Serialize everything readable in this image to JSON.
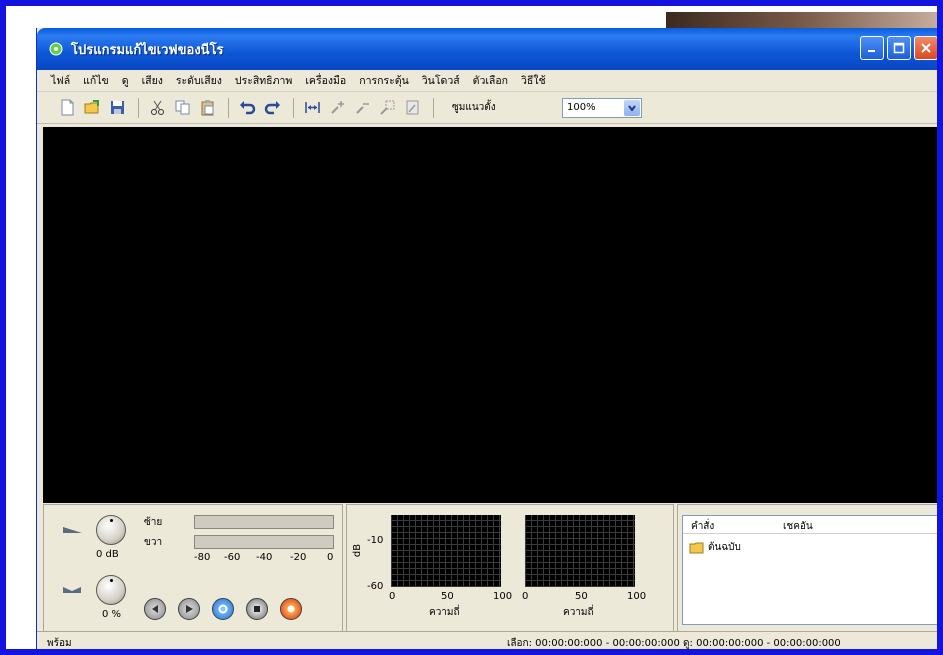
{
  "window": {
    "title": "โปรแกรมแก้ไขเวฟของนีโร",
    "controls": {
      "minimize": "minimize",
      "maximize": "maximize",
      "close": "close"
    }
  },
  "menu": [
    "ไฟล์",
    "แก้ไข",
    "ดู",
    "เสียง",
    "ระดับเสียง",
    "ประสิทธิภาพ",
    "เครื่องมือ",
    "การกระตุ้น",
    "วินโดวส์",
    "ตัวเลือก",
    "วิธีใช้"
  ],
  "toolbar": {
    "icons": [
      "new-file-icon",
      "open-folder-icon",
      "save-icon",
      "cut-icon",
      "copy-icon",
      "paste-icon",
      "undo-icon",
      "redo-icon",
      "fit-width-icon",
      "zoom-in-icon",
      "zoom-out-icon",
      "zoom-selection-icon",
      "zoom-full-icon"
    ],
    "zoom_label": "ซูมแนวตั้ง",
    "zoom_value": "100%"
  },
  "volume_panel": {
    "left_label": "ซ้าย",
    "right_label": "ขวา",
    "knob1_value": "0 dB",
    "knob2_value": "0 %",
    "meter_ticks": [
      "-80",
      "-60",
      "-40",
      "-20",
      "0"
    ]
  },
  "spectrum": {
    "y_label": "dB",
    "y_ticks": [
      "-10",
      "-60"
    ],
    "x_ticks_left": [
      "0",
      "50",
      "100"
    ],
    "x_ticks_right": [
      "0",
      "50",
      "100"
    ],
    "x_label": "ความถี่"
  },
  "files": {
    "col_name": "คำสั่ง",
    "col_dock": "เชคอัน",
    "item": "ต้นฉบับ"
  },
  "status": {
    "left": "พร้อม",
    "right": "เลือก: 00:00:00:000 - 00:00:00:000  ดู: 00:00:00:000 - 00:00:00:000"
  }
}
